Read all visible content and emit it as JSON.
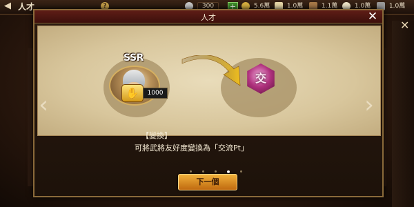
{
  "topbar": {
    "title": "人才",
    "help": "?",
    "resources": [
      {
        "icon": "silver-coin-icon",
        "value": "300"
      },
      {
        "icon": "gold-coin-icon",
        "value": "5.6萬"
      },
      {
        "icon": "scroll-icon",
        "value": "1.0萬"
      },
      {
        "icon": "wood-icon",
        "value": "1.1萬"
      },
      {
        "icon": "rice-icon",
        "value": "1.0萬"
      },
      {
        "icon": "stone-icon",
        "value": "1.0萬"
      }
    ],
    "plus": "+"
  },
  "modal": {
    "title": "人才",
    "close": "✕",
    "ssr": "SSR",
    "friendship_count": "1000",
    "token_char": "交",
    "desc_title": "【變換】",
    "desc_text": "可將武將友好度變換為「交流Pt」",
    "dots": {
      "total": 5,
      "active": 4
    },
    "next_button": "下一個",
    "nav_left": "‹",
    "nav_right": "›"
  },
  "colors": {
    "header": "#5e1d16",
    "button": "#e09a2a",
    "parchment": "#e0d0aa",
    "token": "#b0327e"
  }
}
